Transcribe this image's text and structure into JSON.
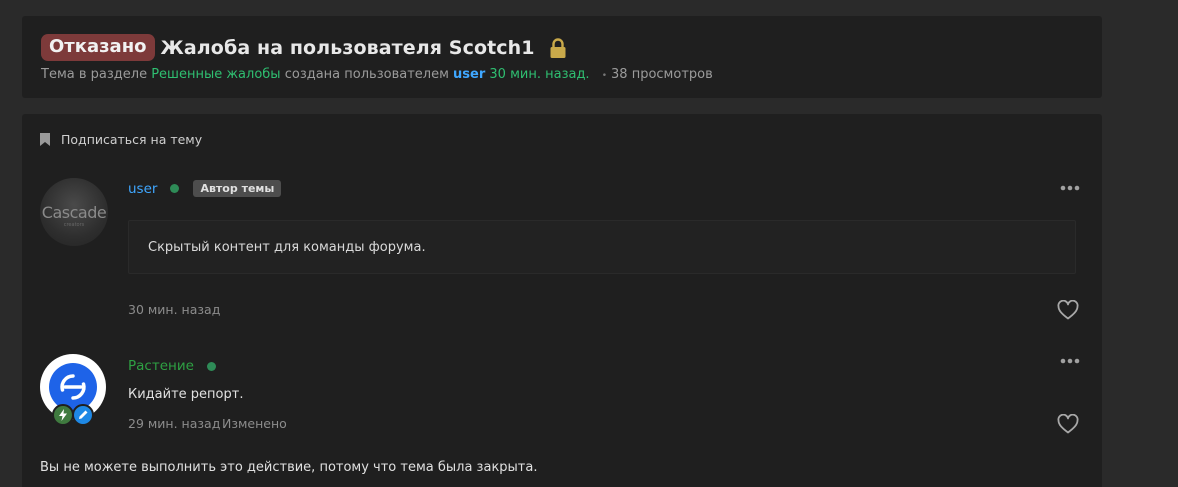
{
  "thread": {
    "status": "Отказано",
    "title": "Жалоба на пользователя Scotch1",
    "meta": {
      "prefix": "Тема в разделе",
      "section": "Решенные жалобы",
      "created_by": "создана пользователем",
      "author": "user",
      "time": "30 мин. назад.",
      "views": "38 просмотров"
    },
    "subscribe_label": "Подписаться на тему"
  },
  "posts": [
    {
      "username": "user",
      "avatar_text": "Cascade",
      "avatar_subtext": "creators",
      "badge": "Автор темы",
      "content": "Скрытый контент для команды форума.",
      "date": "30 мин. назад"
    },
    {
      "username": "Растение",
      "content": "Кидайте репорт.",
      "date": "29 мин. назад",
      "edited": "Изменено"
    }
  ],
  "closed_notice": "Вы не можете выполнить это действие, потому что тема была закрыта.",
  "colors": {
    "status_badge": "#7d3a3a",
    "link_green": "#2fbf71",
    "link_blue": "#3fa7ff",
    "online": "#2e8b57",
    "lock": "#c9a94a"
  },
  "icons": [
    "lock-icon",
    "bookmark-icon",
    "more-icon",
    "heart-icon",
    "bolt-icon",
    "pencil-icon"
  ]
}
